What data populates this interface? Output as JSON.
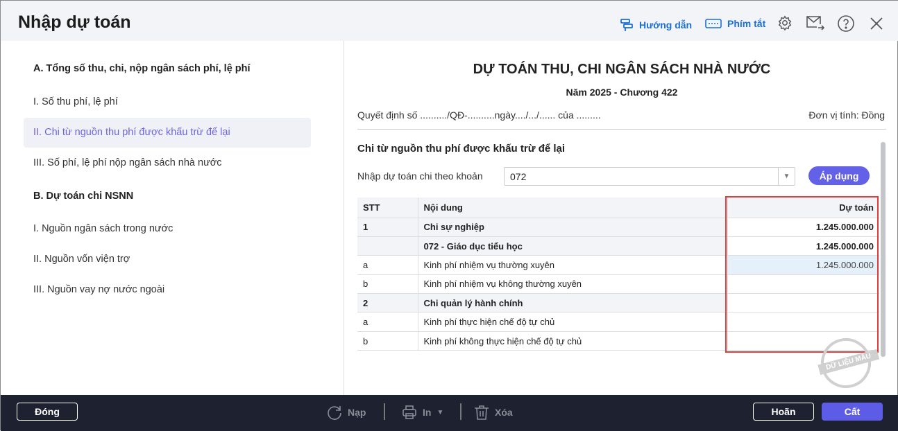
{
  "header": {
    "title": "Nhập dự toán",
    "guide": "Hướng dẫn",
    "shortcuts": "Phím tắt"
  },
  "sidebar": {
    "items": [
      {
        "label": "A. Tổng số thu, chi, nộp ngân sách phí, lệ phí",
        "type": "section"
      },
      {
        "label": "I. Số thu phí, lệ phí"
      },
      {
        "label": "II. Chi từ nguồn thu phí được khấu trừ để lại",
        "active": true
      },
      {
        "label": "III. Số phí, lệ phí nộp ngân sách nhà nước"
      },
      {
        "label": "B. Dự toán chi NSNN",
        "type": "section"
      },
      {
        "label": "I. Nguồn ngân sách trong nước"
      },
      {
        "label": "II. Nguồn vốn viện trợ"
      },
      {
        "label": "III. Nguồn vay nợ nước ngoài"
      }
    ]
  },
  "doc": {
    "title": "DỰ TOÁN THU, CHI NGÂN SÁCH NHÀ NƯỚC",
    "subtitle": "Năm 2025 - Chương 422",
    "decision": "Quyết định số ........../QĐ-..........ngày..../.../...... của .........",
    "unit": "Đơn vị tính: Đồng",
    "section": "Chi từ nguồn thu phí được khấu trừ để lại",
    "khoan_label": "Nhập dự toán chi theo khoản",
    "khoan_value": "072",
    "apply": "Áp dụng"
  },
  "table": {
    "headers": [
      "STT",
      "Nội dung",
      "Dự toán"
    ],
    "rows": [
      {
        "stt": "1",
        "content": "Chi sự nghiệp",
        "value": "1.245.000.000",
        "bold": true
      },
      {
        "stt": "",
        "content": "072 - Giáo dục tiểu học",
        "value": "1.245.000.000",
        "bold": true
      },
      {
        "stt": "a",
        "content": "Kinh phí nhiệm vụ thường xuyên",
        "value": "1.245.000.000",
        "selected": true
      },
      {
        "stt": "b",
        "content": "Kinh phí nhiệm vụ không thường xuyên",
        "value": ""
      },
      {
        "stt": "2",
        "content": "Chi quản lý hành chính",
        "value": "",
        "bold": true
      },
      {
        "stt": "a",
        "content": "Kinh phí thực hiện chế độ tự chủ",
        "value": ""
      },
      {
        "stt": "b",
        "content": "Kinh phí không thực hiện chế độ tự chủ",
        "value": ""
      }
    ]
  },
  "watermark": "DỮ LIỆU MẪU",
  "footer": {
    "close": "Đóng",
    "reload": "Nạp",
    "print": "In",
    "delete": "Xóa",
    "cancel": "Hoãn",
    "save": "Cất"
  }
}
